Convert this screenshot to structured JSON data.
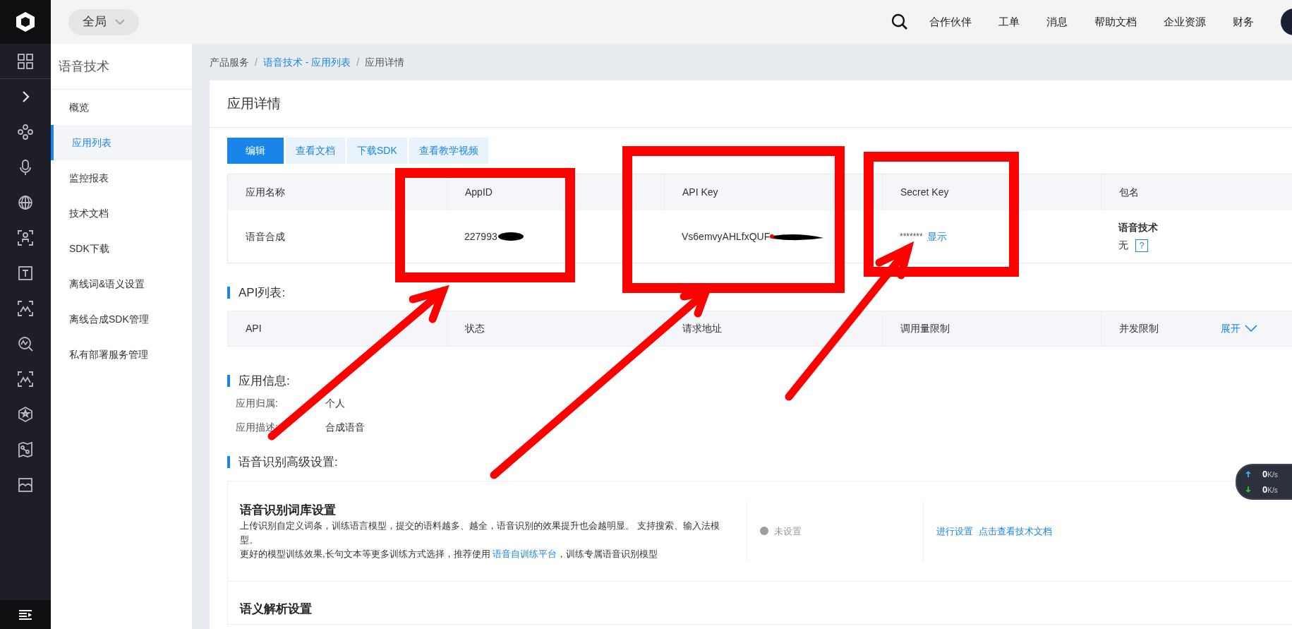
{
  "top_bar": {
    "scope": "全局",
    "nav": [
      "合作伙伴",
      "工单",
      "消息",
      "帮助文档",
      "企业资源",
      "财务"
    ]
  },
  "sidebar": {
    "title": "语音技术",
    "items": [
      {
        "label": "概览",
        "selected": false
      },
      {
        "label": "应用列表",
        "selected": true
      },
      {
        "label": "监控报表",
        "selected": false
      },
      {
        "label": "技术文档",
        "selected": false
      },
      {
        "label": "SDK下载",
        "selected": false
      },
      {
        "label": "离线词&语义设置",
        "selected": false
      },
      {
        "label": "离线合成SDK管理",
        "selected": false
      },
      {
        "label": "私有部署服务管理",
        "selected": false
      }
    ]
  },
  "breadcrumb": [
    {
      "label": "产品服务",
      "kind": "text"
    },
    {
      "separator": "/",
      "label": "语音技术 - 应用列表",
      "kind": "link"
    },
    {
      "separator": "/",
      "label": "应用详情",
      "kind": "text"
    }
  ],
  "page_title": "应用详情",
  "actions": [
    {
      "label": "编辑",
      "kind": "primary"
    },
    {
      "label": "查看文档",
      "kind": "secondary"
    },
    {
      "label": "下载SDK",
      "kind": "secondary"
    },
    {
      "label": "查看教学视频",
      "kind": "secondary"
    }
  ],
  "app_table": {
    "columns": [
      "应用名称",
      "AppID",
      "API Key",
      "Secret Key",
      "包名"
    ],
    "row": [
      {
        "kind": "text",
        "text": "语音合成"
      },
      {
        "kind": "redacted",
        "text": "227993"
      },
      {
        "kind": "redacted",
        "text": "Vs6emvyAHLfxQUF"
      },
      {
        "kind": "secret",
        "text": "*******",
        "link": "显示"
      },
      {
        "kind": "package",
        "title": "语音技术",
        "text": "无",
        "help": "?"
      }
    ]
  },
  "api_list": {
    "heading": "API列表:",
    "columns": [
      "API",
      "状态",
      "请求地址",
      "调用量限制",
      "并发限制"
    ],
    "toggle": "展开"
  },
  "app_info": {
    "heading": "应用信息:",
    "fields": [
      {
        "label": "应用归属:",
        "value": "个人"
      },
      {
        "label": "应用描述:",
        "value": "合成语音"
      }
    ]
  },
  "advanced": {
    "heading": "语音识别高级设置:",
    "sections": [
      {
        "title": "语音识别词库设置",
        "description": "上传识别自定义词条，训练语言模型，提交的语料越多、越全，语音识别的效果提升也会越明显。 支持搜索、输入法模型。",
        "note_before": "更好的模型训练效果,长句文本等更多训练方式选择，推荐使用 ",
        "note_link": "语音自训练平台",
        "note_after": "，训练专属语音识别模型",
        "configured": false,
        "status": "未设置",
        "links": [
          "进行设置",
          "点击查看技术文档"
        ]
      },
      {
        "title": "语义解析设置"
      }
    ]
  },
  "network_widget": [
    {
      "kind": "up",
      "value": "0",
      "unit": "K/s"
    },
    {
      "kind": "down",
      "value": "0",
      "unit": "K/s"
    }
  ]
}
